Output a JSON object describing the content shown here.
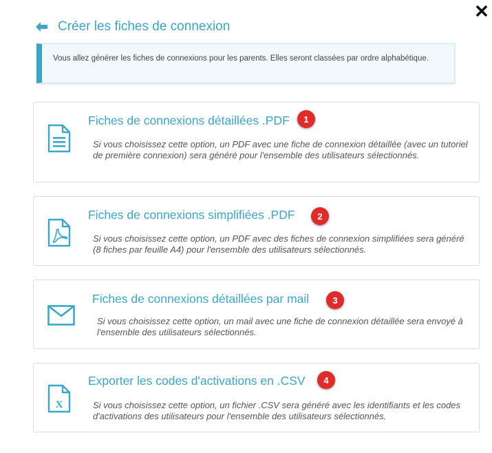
{
  "dialog": {
    "title": "Créer les fiches de connexion",
    "info": "Vous allez générer les fiches de connexions pour les parents. Elles seront classées par ordre alphabétique."
  },
  "colors": {
    "accent": "#3aa6c9",
    "badge": "#e02b2b"
  },
  "options": [
    {
      "icon": "document-icon",
      "title": "Fiches de connexions détaillées .PDF",
      "badge": "1",
      "description": "Si vous choisissez cette option, un PDF avec une fiche de connexion détaillée (avec un tutoriel de première connexion) sera généré pour l'ensemble des utilisateurs sélectionnés."
    },
    {
      "icon": "pdf-file-icon",
      "title": "Fiches de connexions simplifiées .PDF",
      "badge": "2",
      "description": "Si vous choisissez cette option, un PDF avec des fiches de connexion simplifiées sera généré (8 fiches par feuille A4) pour l'ensemble des utilisateurs sélectionnés."
    },
    {
      "icon": "envelope-icon",
      "title": "Fiches de connexions détaillées par mail",
      "badge": "3",
      "description": "Si vous choisissez cette option, un mail avec une fiche de connexion détaillée sera envoyé à l'ensemble des utilisateurs sélectionnés."
    },
    {
      "icon": "excel-file-icon",
      "title": "Exporter les codes d'activations en .CSV",
      "badge": "4",
      "description": "Si vous choisissez cette option, un fichier .CSV sera généré avec les identifiants et les codes d'activations des utilisateurs pour l'ensemble des utilisateurs sélectionnés."
    }
  ]
}
